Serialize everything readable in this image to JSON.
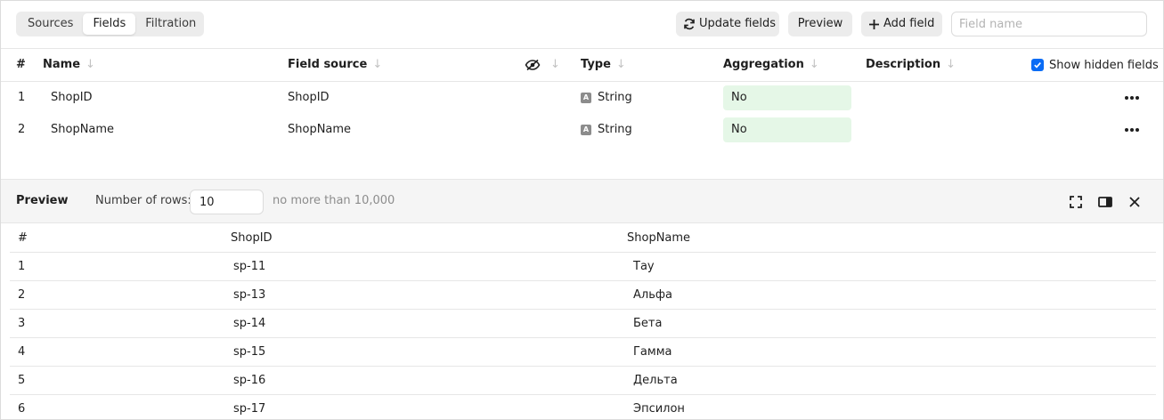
{
  "tabs": [
    "Sources",
    "Fields",
    "Filtration"
  ],
  "toolbar": {
    "update_label": "Update fields",
    "preview_label": "Preview",
    "add_label": "Add field",
    "search_placeholder": "Field name",
    "update_icon": "refresh-icon",
    "add_icon": "plus-icon"
  },
  "fields_table": {
    "headers": {
      "num": "#",
      "name": "Name",
      "source": "Field source",
      "type": "Type",
      "aggregation": "Aggregation",
      "description": "Description"
    },
    "show_hidden_label": "Show hidden fields",
    "rows": [
      {
        "num": "1",
        "name": "ShopID",
        "source": "ShopID",
        "type": "String",
        "aggregation": "No"
      },
      {
        "num": "2",
        "name": "ShopName",
        "source": "ShopName",
        "type": "String",
        "aggregation": "No"
      }
    ]
  },
  "preview": {
    "title": "Preview",
    "rows_label": "Number of rows:",
    "rows_value": "10",
    "hint": "no more than 10,000",
    "headers": {
      "num": "#",
      "c1": "ShopID",
      "c2": "ShopName"
    },
    "rows": [
      {
        "num": "1",
        "c1": "sp-11",
        "c2": "Тау"
      },
      {
        "num": "2",
        "c1": "sp-13",
        "c2": "Альфа"
      },
      {
        "num": "3",
        "c1": "sp-14",
        "c2": "Бета"
      },
      {
        "num": "4",
        "c1": "sp-15",
        "c2": "Гамма"
      },
      {
        "num": "5",
        "c1": "sp-16",
        "c2": "Дельта"
      },
      {
        "num": "6",
        "c1": "sp-17",
        "c2": "Эпсилон"
      }
    ]
  },
  "colors": {
    "accent": "#0a6cf5",
    "aggregation_bg": "#e5f7e7",
    "button_bg": "#ececec"
  }
}
